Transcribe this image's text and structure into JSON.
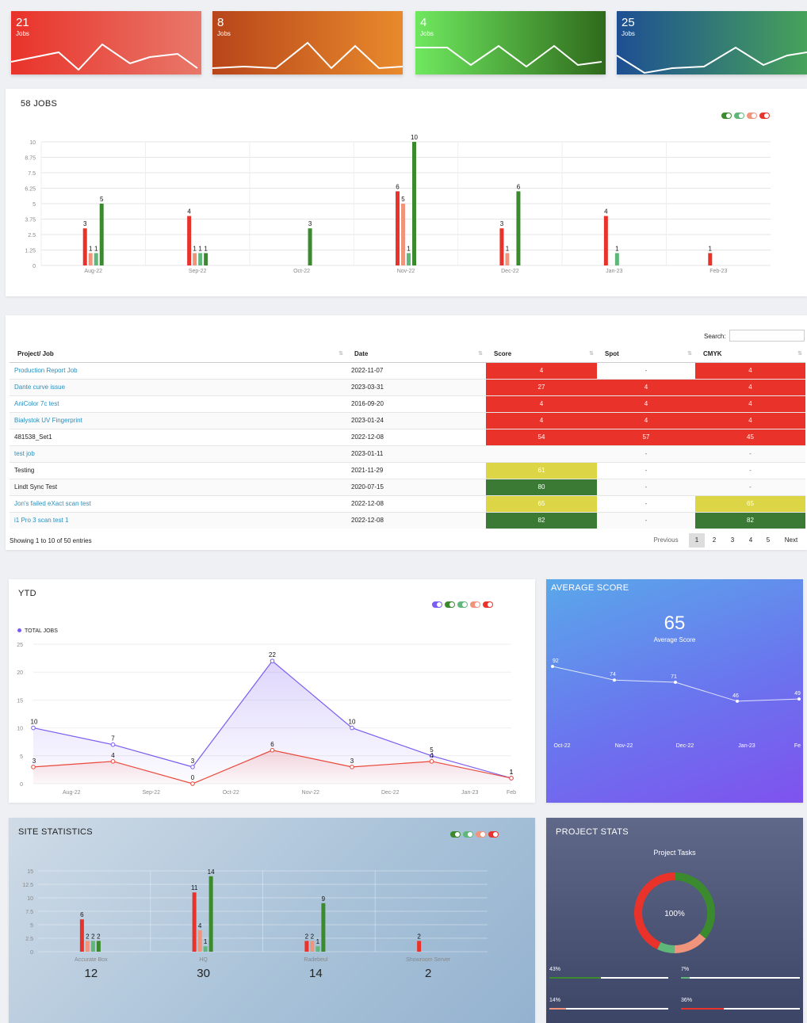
{
  "top_stats": [
    {
      "value": "21",
      "label": "Jobs"
    },
    {
      "value": "8",
      "label": "Jobs"
    },
    {
      "value": "4",
      "label": "Jobs"
    },
    {
      "value": "25",
      "label": "Jobs"
    }
  ],
  "jobs_chart": {
    "title": "58 JOBS",
    "chart_data": {
      "type": "bar",
      "categories": [
        "Aug-22",
        "Sep-22",
        "Oct-22",
        "Nov-22",
        "Dec-22",
        "Jan-23",
        "Feb-23"
      ],
      "yticks": [
        "0",
        "1.25",
        "2.5",
        "3.75",
        "5",
        "6.25",
        "7.5",
        "8.75",
        "10"
      ],
      "ylim": [
        0,
        10
      ],
      "series": [
        {
          "color": "#e9332a",
          "values": [
            3,
            4,
            null,
            6,
            3,
            4,
            1
          ]
        },
        {
          "color": "#f0957c",
          "values": [
            1,
            1,
            null,
            5,
            1,
            null,
            null
          ]
        },
        {
          "color": "#5fb87a",
          "values": [
            1,
            1,
            null,
            1,
            null,
            1,
            null
          ]
        },
        {
          "color": "#3b8a2e",
          "values": [
            5,
            1,
            3,
            10,
            6,
            null,
            null
          ]
        }
      ]
    }
  },
  "table": {
    "search_label": "Search:",
    "search_value": "",
    "columns": [
      "Project/ Job",
      "Date",
      "Score",
      "Spot",
      "CMYK"
    ],
    "rows": [
      {
        "name": "Production Report Job",
        "link": true,
        "date": "2022-11-07",
        "score": "4",
        "score_c": "red",
        "spot": "-",
        "spot_c": "",
        "cmyk": "4",
        "cmyk_c": "red"
      },
      {
        "name": "Dante curve issue",
        "link": true,
        "date": "2023-03-31",
        "score": "27",
        "score_c": "red",
        "spot": "4",
        "spot_c": "red",
        "cmyk": "4",
        "cmyk_c": "red"
      },
      {
        "name": "AniColor 7c test",
        "link": true,
        "date": "2016-09-20",
        "score": "4",
        "score_c": "red",
        "spot": "4",
        "spot_c": "red",
        "cmyk": "4",
        "cmyk_c": "red"
      },
      {
        "name": "Bialystok UV Fingerprint",
        "link": true,
        "date": "2023-01-24",
        "score": "4",
        "score_c": "red",
        "spot": "4",
        "spot_c": "red",
        "cmyk": "4",
        "cmyk_c": "red"
      },
      {
        "name": "481538_Set1",
        "link": false,
        "date": "2022-12-08",
        "score": "54",
        "score_c": "red",
        "spot": "57",
        "spot_c": "red",
        "cmyk": "45",
        "cmyk_c": "red"
      },
      {
        "name": "test job",
        "link": true,
        "date": "2023-01-11",
        "score": "",
        "score_c": "",
        "spot": "-",
        "spot_c": "",
        "cmyk": "-",
        "cmyk_c": ""
      },
      {
        "name": "Testing",
        "link": false,
        "date": "2021-11-29",
        "score": "61",
        "score_c": "yel",
        "spot": "-",
        "spot_c": "",
        "cmyk": "-",
        "cmyk_c": ""
      },
      {
        "name": "Lindt Sync Test",
        "link": false,
        "date": "2020-07-15",
        "score": "80",
        "score_c": "grn",
        "spot": "-",
        "spot_c": "",
        "cmyk": "-",
        "cmyk_c": ""
      },
      {
        "name": "Jon's failed eXact scan test",
        "link": true,
        "date": "2022-12-08",
        "score": "65",
        "score_c": "yel",
        "spot": "-",
        "spot_c": "",
        "cmyk": "65",
        "cmyk_c": "yel"
      },
      {
        "name": "i1 Pro 3 scan test 1",
        "link": true,
        "date": "2022-12-08",
        "score": "82",
        "score_c": "grn",
        "spot": "-",
        "spot_c": "",
        "cmyk": "82",
        "cmyk_c": "grn"
      }
    ],
    "info": "Showing 1 to 10 of 50 entries",
    "pagination": {
      "previous": "Previous",
      "pages": [
        "1",
        "2",
        "3",
        "4",
        "5"
      ],
      "next": "Next"
    }
  },
  "ytd": {
    "title": "YTD",
    "legend": "TOTAL JOBS",
    "chart_data": {
      "type": "line",
      "x": [
        "Aug-22",
        "Sep-22",
        "Oct-22",
        "Nov-22",
        "Dec-22",
        "Jan-23",
        "Feb-23"
      ],
      "x_tick_labels": [
        "Aug-22",
        "Sep-22",
        "Oct-22",
        "Nov-22",
        "Dec-22",
        "Jan-23",
        "Feb"
      ],
      "yticks": [
        "0",
        "5",
        "10",
        "15",
        "20",
        "25"
      ],
      "ylim": [
        0,
        25
      ],
      "series": [
        {
          "name": "TOTAL JOBS",
          "color": "#7b5cf0",
          "values": [
            10,
            7,
            3,
            22,
            10,
            5,
            1
          ]
        },
        {
          "color": "#e9483a",
          "values": [
            3,
            4,
            0,
            6,
            3,
            4,
            1
          ]
        }
      ]
    }
  },
  "avg_score": {
    "title": "AVERAGE SCORE",
    "value": "65",
    "label": "Average Score",
    "chart_data": {
      "type": "line",
      "x": [
        "Oct-22",
        "Nov-22",
        "Dec-22",
        "Jan-23",
        "Fe"
      ],
      "values": [
        92,
        74,
        71,
        46,
        49
      ]
    }
  },
  "site_stats": {
    "title": "SITE STATISTICS",
    "chart_data": {
      "type": "bar",
      "categories": [
        "Accurate Box",
        "HQ",
        "Radebeul",
        "Showroom Server"
      ],
      "totals": [
        "12",
        "30",
        "14",
        "2"
      ],
      "yticks": [
        "0",
        "2.5",
        "5",
        "7.5",
        "10",
        "12.5",
        "15"
      ],
      "ylim": [
        0,
        15
      ],
      "series": [
        {
          "color": "#e9332a",
          "values": [
            6,
            11,
            2,
            2
          ]
        },
        {
          "color": "#f0957c",
          "values": [
            2,
            4,
            2,
            null
          ]
        },
        {
          "color": "#5fb87a",
          "values": [
            2,
            1,
            1,
            null
          ]
        },
        {
          "color": "#3b8a2e",
          "values": [
            2,
            14,
            9,
            null
          ]
        }
      ]
    }
  },
  "project_stats": {
    "title": "PROJECT STATS",
    "subtitle": "Project Tasks",
    "center": "100%",
    "chart_data": {
      "type": "pie",
      "slices": [
        {
          "color": "#e9332a",
          "value": 43
        },
        {
          "color": "#5fb87a",
          "value": 7
        },
        {
          "color": "#f0957c",
          "value": 14
        },
        {
          "color": "#3b8a2e",
          "value": 36
        }
      ]
    },
    "bars": [
      {
        "label": "43%",
        "value": 43,
        "color": "#3b8a2e"
      },
      {
        "label": "7%",
        "value": 7,
        "color": "#5fb87a"
      },
      {
        "label": "14%",
        "value": 14,
        "color": "#f0957c"
      },
      {
        "label": "36%",
        "value": 36,
        "color": "#e9332a"
      }
    ]
  }
}
